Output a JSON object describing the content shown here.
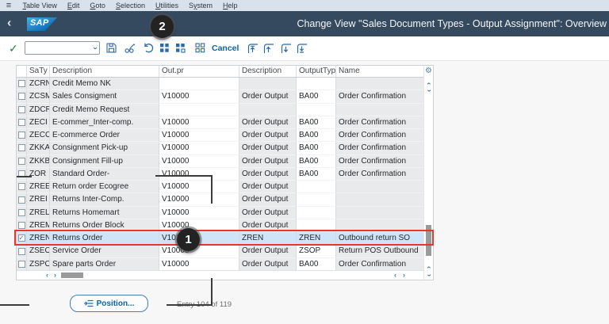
{
  "colors": {
    "titlebar-bg": "#354a5f",
    "menubar-bg": "#d9e2ec",
    "accent-blue": "#2a6aa8",
    "link-blue": "#0b64ad",
    "ok-green": "#1d8038",
    "row-gray": "#e9eaec",
    "selected-row": "#cfe4f7",
    "highlight-red": "#e5372b",
    "text-gray": "#6a6d70",
    "logo-blue-1": "#49b0e4",
    "logo-blue-2": "#0e6fb8",
    "page-bg": "#f7f7f7"
  },
  "menubar": {
    "menu_icon": "≡",
    "items": [
      {
        "label": "Table View",
        "mnemonic": 0
      },
      {
        "label": "Edit",
        "mnemonic": 0
      },
      {
        "label": "Goto",
        "mnemonic": 0
      },
      {
        "label": "Selection",
        "mnemonic": 0
      },
      {
        "label": "Utilities",
        "mnemonic": 0
      },
      {
        "label": "System",
        "mnemonic": 1
      },
      {
        "label": "Help",
        "mnemonic": 0
      }
    ]
  },
  "titlebar": {
    "back_icon": "‹",
    "logo_text": "SAP",
    "title": "Change View \"Sales Document Types - Output Assignment\": Overview"
  },
  "toolbar": {
    "ok_icon": "✓",
    "command_field_value": "",
    "cancel_label": "Cancel",
    "icon_names": [
      "save-icon",
      "display-change-icon",
      "undo-icon",
      "choose-icon",
      "select-block-icon",
      "select-all-icon",
      "first-page-icon",
      "previous-page-icon",
      "next-page-icon",
      "last-page-icon"
    ]
  },
  "table": {
    "columns": [
      "SaTy",
      "Description",
      "Out.pr",
      "Description",
      "OutputType",
      "Name"
    ],
    "gear_icon": "⚙",
    "rows": [
      {
        "checked": false,
        "selected": false,
        "saty": "ZCRN",
        "description": "Credit Memo NK",
        "outpr": "",
        "description2": "",
        "output_type": "",
        "name": ""
      },
      {
        "checked": false,
        "selected": false,
        "saty": "ZCSM",
        "description": "Sales Consigment",
        "outpr": "V10000",
        "description2": "Order Output",
        "output_type": "BA00",
        "name": "Order Confirmation"
      },
      {
        "checked": false,
        "selected": false,
        "saty": "ZDCR",
        "description": "Credit Memo Request",
        "outpr": "",
        "description2": "",
        "output_type": "",
        "name": ""
      },
      {
        "checked": false,
        "selected": false,
        "saty": "ZECI",
        "description": "E-commer_Inter-comp.",
        "outpr": "V10000",
        "description2": "Order Output",
        "output_type": "BA00",
        "name": "Order Confirmation"
      },
      {
        "checked": false,
        "selected": false,
        "saty": "ZECO",
        "description": "E-commerce Order",
        "outpr": "V10000",
        "description2": "Order Output",
        "output_type": "BA00",
        "name": "Order Confirmation"
      },
      {
        "checked": false,
        "selected": false,
        "saty": "ZKKA",
        "description": "Consignment Pick-up",
        "outpr": "V10000",
        "description2": "Order Output",
        "output_type": "BA00",
        "name": "Order Confirmation"
      },
      {
        "checked": false,
        "selected": false,
        "saty": "ZKKB",
        "description": "Consignment Fill-up",
        "outpr": "V10000",
        "description2": "Order Output",
        "output_type": "BA00",
        "name": "Order Confirmation"
      },
      {
        "checked": false,
        "selected": false,
        "saty": "ZOR",
        "description": "Standard Order-",
        "outpr": "V10000",
        "description2": "Order Output",
        "output_type": "BA00",
        "name": "Order Confirmation"
      },
      {
        "checked": false,
        "selected": false,
        "saty": "ZREE",
        "description": "Return order Ecogree",
        "outpr": "V10000",
        "description2": "Order Output",
        "output_type": "",
        "name": ""
      },
      {
        "checked": false,
        "selected": false,
        "saty": "ZREI",
        "description": "Returns Inter-Comp.",
        "outpr": "V10000",
        "description2": "Order Output",
        "output_type": "",
        "name": ""
      },
      {
        "checked": false,
        "selected": false,
        "saty": "ZREL",
        "description": "Returns Homemart",
        "outpr": "V10000",
        "description2": "Order Output",
        "output_type": "",
        "name": ""
      },
      {
        "checked": false,
        "selected": false,
        "saty": "ZREM",
        "description": "Returns Order Block",
        "outpr": "V10000",
        "description2": "Order Output",
        "output_type": "",
        "name": ""
      },
      {
        "checked": true,
        "selected": true,
        "saty": "ZREN",
        "description": "Returns Order",
        "outpr": "V10100",
        "description2": "ZREN",
        "output_type": "ZREN",
        "name": "Outbound return SO"
      },
      {
        "checked": false,
        "selected": false,
        "saty": "ZSEO",
        "description": "Service Order",
        "outpr": "V10000",
        "description2": "Order Output",
        "output_type": "ZSOP",
        "name": "Return POS Outbound"
      },
      {
        "checked": false,
        "selected": false,
        "saty": "ZSPO",
        "description": "Spare parts Order",
        "outpr": "V10000",
        "description2": "Order Output",
        "output_type": "BA00",
        "name": "Order Confirmation"
      }
    ]
  },
  "footer": {
    "position_label": "Position...",
    "entry_text": "Entry 104 of 119"
  },
  "annotations": {
    "step1": "1",
    "step2": "2"
  }
}
